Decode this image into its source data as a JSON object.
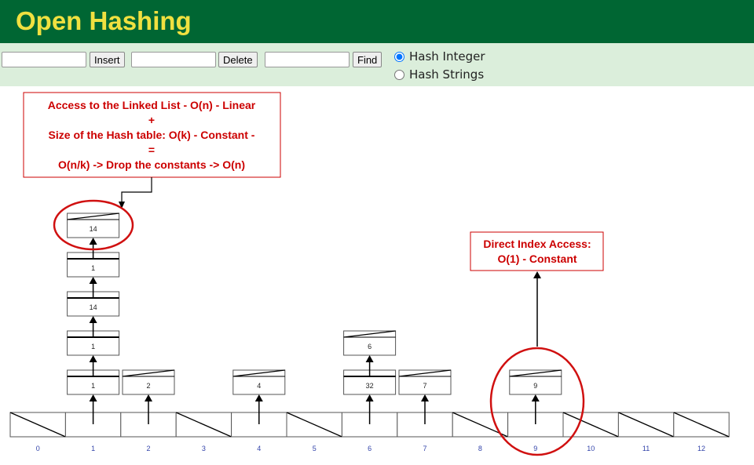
{
  "header": {
    "title": "Open Hashing"
  },
  "toolbar": {
    "insert_value": "",
    "insert_label": "Insert",
    "delete_value": "",
    "delete_label": "Delete",
    "find_value": "",
    "find_label": "Find",
    "radio_integer": "Hash Integer",
    "radio_strings": "Hash Strings",
    "selected": "Hash Integer"
  },
  "table": {
    "indices": [
      "0",
      "1",
      "2",
      "3",
      "4",
      "5",
      "6",
      "7",
      "8",
      "9",
      "10",
      "11",
      "12"
    ],
    "chains": {
      "1": [
        "1",
        "1",
        "14",
        "1",
        "14"
      ],
      "2": [
        "2"
      ],
      "4": [
        "4"
      ],
      "6": [
        "32",
        "6"
      ],
      "7": [
        "7"
      ],
      "9": [
        "9"
      ]
    }
  },
  "annotations": {
    "left": [
      "Access to the Linked List - O(n) - Linear",
      "+",
      "Size of the Hash table: O(k) - Constant -",
      "=",
      "O(n/k) -> Drop the constants -> O(n)"
    ],
    "right": [
      "Direct Index Access:",
      "O(1) - Constant"
    ],
    "color": "#cc0000"
  }
}
